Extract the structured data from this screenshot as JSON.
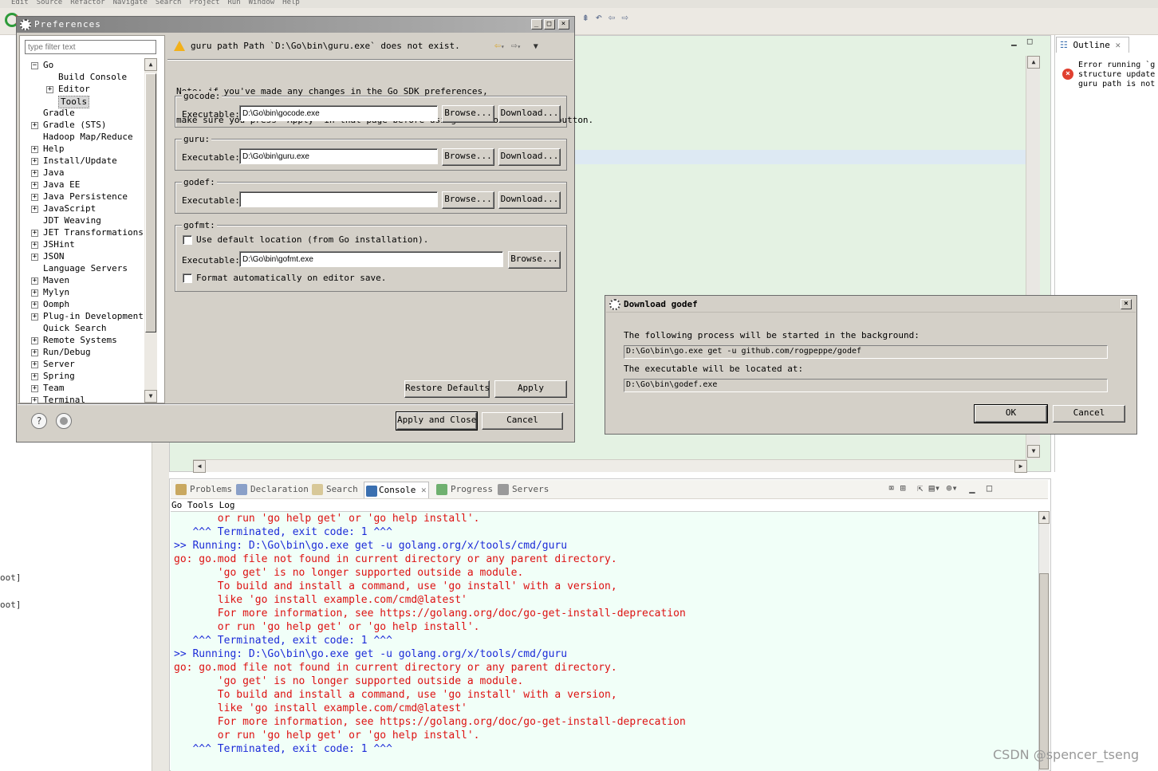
{
  "menubar": {
    "items": [
      "Edit",
      "Source",
      "Refactor",
      "Navigate",
      "Search",
      "Project",
      "Run",
      "Window",
      "Help"
    ]
  },
  "left_fragments": [
    "oot]",
    "oot]"
  ],
  "outline": {
    "tab_label": "Outline",
    "message_lines": [
      "Error running `g",
      "structure update",
      "guru path is not"
    ]
  },
  "preferences": {
    "title": "Preferences",
    "filter_placeholder": "type filter text",
    "tree": [
      {
        "label": "Go",
        "expander": "-"
      },
      {
        "label": "Build Console",
        "expander": ""
      },
      {
        "label": "Editor",
        "expander": "+"
      },
      {
        "label": "Tools",
        "expander": "",
        "selected": true
      },
      {
        "label": "Gradle",
        "expander": ""
      },
      {
        "label": "Gradle (STS)",
        "expander": "+"
      },
      {
        "label": "Hadoop Map/Reduce",
        "expander": ""
      },
      {
        "label": "Help",
        "expander": "+"
      },
      {
        "label": "Install/Update",
        "expander": "+"
      },
      {
        "label": "Java",
        "expander": "+"
      },
      {
        "label": "Java EE",
        "expander": "+"
      },
      {
        "label": "Java Persistence",
        "expander": "+"
      },
      {
        "label": "JavaScript",
        "expander": "+"
      },
      {
        "label": "JDT Weaving",
        "expander": ""
      },
      {
        "label": "JET Transformations",
        "expander": "+"
      },
      {
        "label": "JSHint",
        "expander": "+"
      },
      {
        "label": "JSON",
        "expander": "+"
      },
      {
        "label": "Language Servers",
        "expander": ""
      },
      {
        "label": "Maven",
        "expander": "+"
      },
      {
        "label": "Mylyn",
        "expander": "+"
      },
      {
        "label": "Oomph",
        "expander": "+"
      },
      {
        "label": "Plug-in Development",
        "expander": "+"
      },
      {
        "label": "Quick Search",
        "expander": ""
      },
      {
        "label": "Remote Systems",
        "expander": "+"
      },
      {
        "label": "Run/Debug",
        "expander": "+"
      },
      {
        "label": "Server",
        "expander": "+"
      },
      {
        "label": "Spring",
        "expander": "+"
      },
      {
        "label": "Team",
        "expander": "+"
      },
      {
        "label": "Terminal",
        "expander": "+"
      }
    ],
    "message": "guru path Path `D:\\Go\\bin\\guru.exe` does not exist.",
    "note_lines": [
      "Note: if you've made any changes in the Go SDK preferences,",
      "make sure you press \"Apply\" in that page before using the `Download...` button."
    ],
    "executable_label": "Executable:",
    "browse_label": "Browse...",
    "download_label": "Download...",
    "gocode": {
      "group": "gocode:",
      "value": "D:\\Go\\bin\\gocode.exe"
    },
    "guru": {
      "group": "guru:",
      "value": "D:\\Go\\bin\\guru.exe"
    },
    "godef": {
      "group": "godef:",
      "value": ""
    },
    "gofmt": {
      "group": "gofmt:",
      "use_default_label": "Use default location (from Go installation).",
      "value": "D:\\Go\\bin\\gofmt.exe",
      "format_label": "Format automatically on editor save."
    },
    "restore_defaults": "Restore Defaults",
    "apply": "Apply",
    "apply_close": "Apply and Close",
    "cancel": "Cancel",
    "help_icon": "?"
  },
  "download_dialog": {
    "title": "Download godef",
    "line1": "The following process will be started in the background:",
    "command": "D:\\Go\\bin\\go.exe get -u github.com/rogpeppe/godef",
    "line2": "The executable will be located at:",
    "location": "D:\\Go\\bin\\godef.exe",
    "ok": "OK",
    "cancel": "Cancel"
  },
  "console": {
    "tabs": [
      "Problems",
      "Declaration",
      "Search",
      "Console",
      "Progress",
      "Servers"
    ],
    "active_tab": "Console",
    "title": "Go Tools Log",
    "lines": [
      {
        "text": "       or run 'go help get' or 'go help install'.",
        "color": "red"
      },
      {
        "text": "   ^^^ Terminated, exit code: 1 ^^^",
        "color": "blue"
      },
      {
        "text": ">> Running: D:\\Go\\bin\\go.exe get -u golang.org/x/tools/cmd/guru",
        "color": "blue"
      },
      {
        "text": "go: go.mod file not found in current directory or any parent directory.",
        "color": "red"
      },
      {
        "text": "       'go get' is no longer supported outside a module.",
        "color": "red"
      },
      {
        "text": "       To build and install a command, use 'go install' with a version,",
        "color": "red"
      },
      {
        "text": "       like 'go install example.com/cmd@latest'",
        "color": "red"
      },
      {
        "text": "       For more information, see https://golang.org/doc/go-get-install-deprecation",
        "color": "red"
      },
      {
        "text": "       or run 'go help get' or 'go help install'.",
        "color": "red"
      },
      {
        "text": "   ^^^ Terminated, exit code: 1 ^^^",
        "color": "blue"
      },
      {
        "text": ">> Running: D:\\Go\\bin\\go.exe get -u golang.org/x/tools/cmd/guru",
        "color": "blue"
      },
      {
        "text": "go: go.mod file not found in current directory or any parent directory.",
        "color": "red"
      },
      {
        "text": "       'go get' is no longer supported outside a module.",
        "color": "red"
      },
      {
        "text": "       To build and install a command, use 'go install' with a version,",
        "color": "red"
      },
      {
        "text": "       like 'go install example.com/cmd@latest'",
        "color": "red"
      },
      {
        "text": "       For more information, see https://golang.org/doc/go-get-install-deprecation",
        "color": "red"
      },
      {
        "text": "       or run 'go help get' or 'go help install'.",
        "color": "red"
      },
      {
        "text": "   ^^^ Terminated, exit code: 1 ^^^",
        "color": "blue"
      }
    ]
  },
  "watermark": "CSDN @spencer_tseng",
  "colors": {
    "editor_bg": "#e4f2e3",
    "console_red": "#dd1111",
    "console_blue": "#1c2bd8",
    "dialog_bg": "#d4d0c8"
  }
}
